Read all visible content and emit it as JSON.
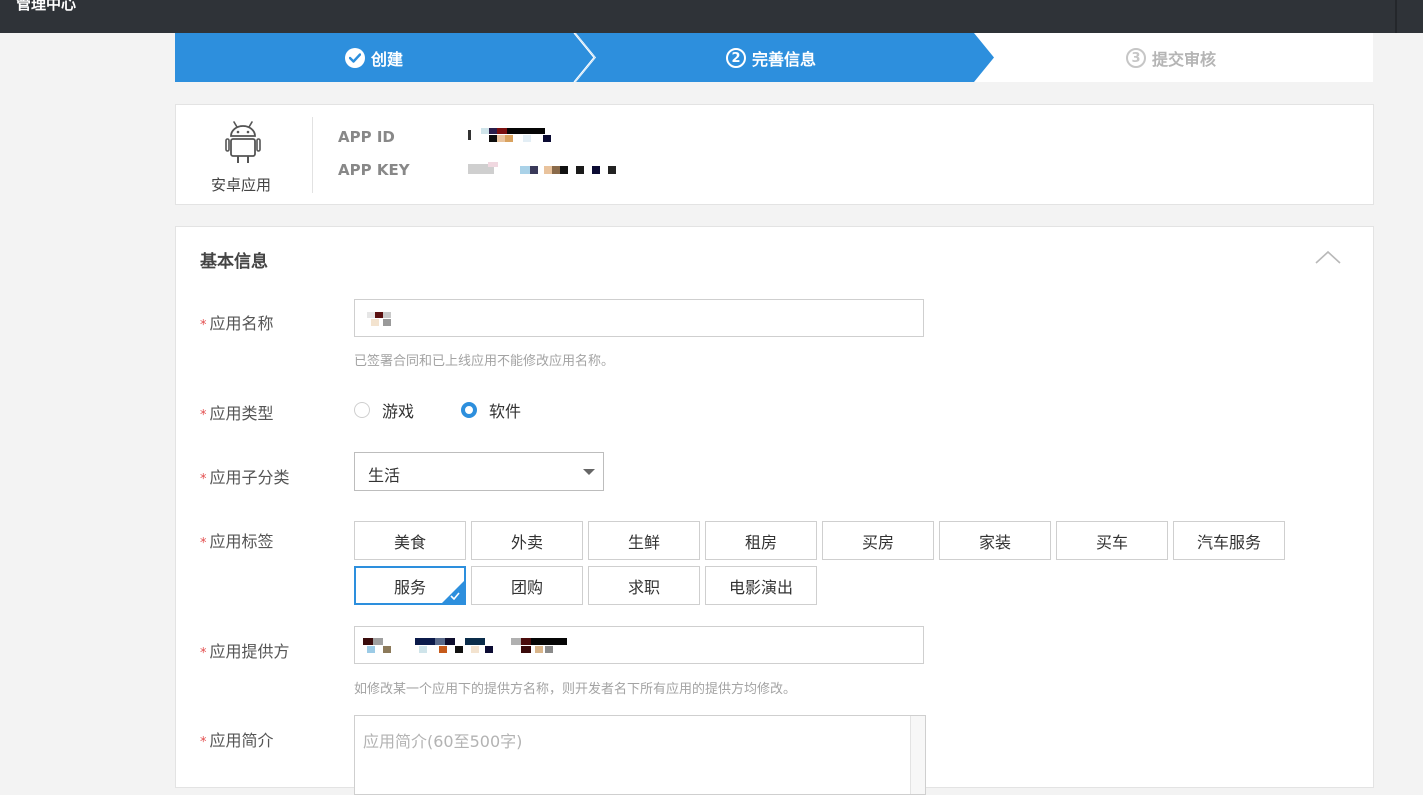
{
  "window": {
    "title": "管理中心"
  },
  "steps": [
    {
      "label": "创建",
      "marker": "check-icon",
      "state": "done"
    },
    {
      "label": "完善信息",
      "marker": "②",
      "state": "active"
    },
    {
      "label": "提交审核",
      "marker": "③",
      "state": "todo"
    }
  ],
  "app": {
    "type_label": "安卓应用",
    "icon": "android-icon",
    "id_label": "APP ID",
    "key_label": "APP KEY"
  },
  "basic_info": {
    "title": "基本信息",
    "collapse_icon": "chevron-up-icon",
    "required_mark": "*",
    "name": {
      "label": "应用名称",
      "hint": "已签署合同和已上线应用不能修改应用名称。"
    },
    "type": {
      "label": "应用类型",
      "options": [
        {
          "label": "游戏",
          "checked": false
        },
        {
          "label": "软件",
          "checked": true
        }
      ]
    },
    "subcategory": {
      "label": "应用子分类",
      "value": "生活"
    },
    "tags": {
      "label": "应用标签",
      "items": [
        {
          "label": "美食",
          "selected": false
        },
        {
          "label": "外卖",
          "selected": false
        },
        {
          "label": "生鲜",
          "selected": false
        },
        {
          "label": "租房",
          "selected": false
        },
        {
          "label": "买房",
          "selected": false
        },
        {
          "label": "家装",
          "selected": false
        },
        {
          "label": "买车",
          "selected": false
        },
        {
          "label": "汽车服务",
          "selected": false
        },
        {
          "label": "服务",
          "selected": true
        },
        {
          "label": "团购",
          "selected": false
        },
        {
          "label": "求职",
          "selected": false
        },
        {
          "label": "电影演出",
          "selected": false
        }
      ]
    },
    "provider": {
      "label": "应用提供方",
      "hint": "如修改某一个应用下的提供方名称，则开发者名下所有应用的提供方均修改。"
    },
    "intro": {
      "label": "应用简介",
      "placeholder": "应用简介(60至500字)"
    }
  },
  "colors": {
    "accent": "#2d8fdd",
    "required": "#e34d4d",
    "topbar": "#2f3338"
  }
}
